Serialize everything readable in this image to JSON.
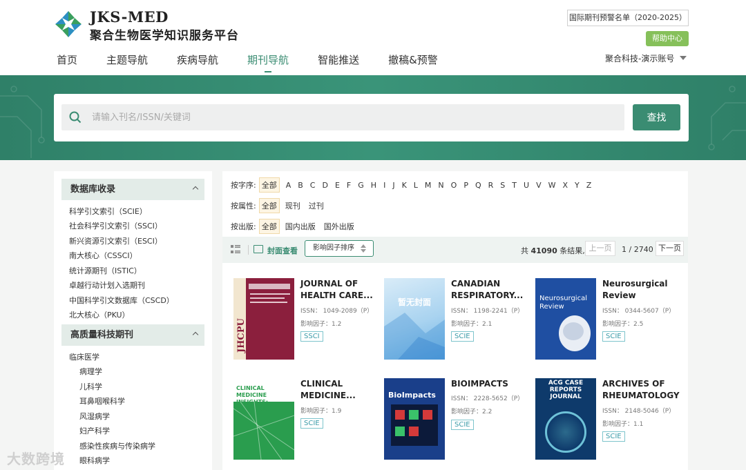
{
  "brand": {
    "name_en": "JKS-MED",
    "name_zh": "聚合生物医学知识服务平台"
  },
  "header": {
    "warning_list": "国际期刊预警名单（2020-2025）",
    "help": "帮助中心",
    "account": "聚合科技-演示账号"
  },
  "nav": [
    "首页",
    "主题导航",
    "疾病导航",
    "期刊导航",
    "智能推送",
    "撤稿&预警"
  ],
  "search": {
    "placeholder": "请输入刊名/ISSN/关键词",
    "button": "查找"
  },
  "sidebar": {
    "section1": {
      "title": "数据库收录",
      "items": [
        "科学引文索引（SCIE）",
        "社会科学引文索引（SSCI）",
        "新兴资源引文索引（ESCI）",
        "南大核心（CSSCI）",
        "统计源期刊（ISTIC）",
        "卓越行动计划入选期刊",
        "中国科学引文数据库（CSCD）",
        "北大核心（PKU）"
      ]
    },
    "section2": {
      "title": "高质量科技期刊",
      "category": "临床医学",
      "subitems": [
        "病理学",
        "儿科学",
        "耳鼻咽喉科学",
        "风湿病学",
        "妇产科学",
        "感染性疾病与传染病学",
        "眼科病学"
      ]
    }
  },
  "filters": {
    "alpha_label": "按字序:",
    "alpha_all": "全部",
    "letters": [
      "A",
      "B",
      "C",
      "D",
      "E",
      "F",
      "G",
      "H",
      "I",
      "J",
      "K",
      "L",
      "M",
      "N",
      "O",
      "P",
      "Q",
      "R",
      "S",
      "T",
      "U",
      "V",
      "W",
      "X",
      "Y",
      "Z"
    ],
    "attr_label": "按属性:",
    "attr": [
      "全部",
      "现刊",
      "过刊"
    ],
    "pub_label": "按出版:",
    "pub": [
      "全部",
      "国内出版",
      "国外出版"
    ]
  },
  "toolbar": {
    "cover_view": "封面查看",
    "sort": "影响因子排序",
    "total_prefix": "共",
    "total": "41090",
    "total_suffix": "条结果,",
    "prev": "上一页",
    "page": "1 / 2740",
    "next": "下一页"
  },
  "journals": [
    {
      "title": "JOURNAL OF HEALTH CARE...",
      "issn": "ISSN： 1049-2089（P）",
      "if": "影响因子：1.2",
      "tag": "SSCI",
      "cover_text": "JHCPU"
    },
    {
      "title": "CANADIAN RESPIRATORY...",
      "issn": "ISSN： 1198-2241（P）",
      "if": "影响因子：2.1",
      "tag": "SCIE",
      "cover_text": "暂无封面"
    },
    {
      "title": "Neurosurgical Review",
      "issn": "ISSN： 0344-5607（P）",
      "if": "影响因子：2.5",
      "tag": "SCIE",
      "cover_text": "Neurosurgical Review"
    },
    {
      "title": "CLINICAL MEDICINE...",
      "issn": "",
      "if": "影响因子：1.9",
      "tag": "SCIE",
      "cover_text": "CLINICAL MEDICINE INSIGHTS: ONCOLOGY"
    },
    {
      "title": "BIOIMPACTS",
      "issn": "ISSN： 2228-5652（P）",
      "if": "影响因子：2.2",
      "tag": "SCIE",
      "cover_text": "BioImpacts"
    },
    {
      "title": "ARCHIVES OF RHEUMATOLOGY",
      "issn": "ISSN： 2148-5046（P）",
      "if": "影响因子：1.1",
      "tag": "SCIE",
      "cover_text": "ACG CASE REPORTS JOURNAL"
    }
  ],
  "watermark": "大数跨境",
  "colors": {
    "primary": "#3a8c72",
    "help": "#86c05a",
    "tag": "#3a9ba8"
  }
}
